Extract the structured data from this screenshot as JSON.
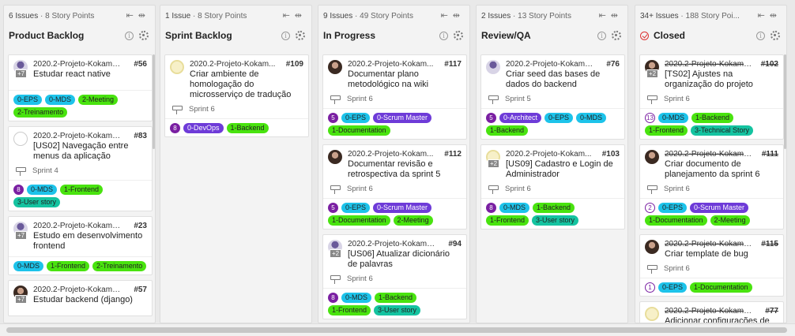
{
  "columns": [
    {
      "meta_count": "6 Issues",
      "meta_points": "8 Story Points",
      "title": "Product Backlog",
      "closed": false,
      "cards": [
        {
          "project": "2020.2-Projeto-Kokama...",
          "number": "#56",
          "title": "Estudar react native",
          "avatar": "purple",
          "plus": "+7",
          "sprint": "",
          "points": "",
          "labels": [
            {
              "text": "0-EPS",
              "color": "#1dc3ea"
            },
            {
              "text": "0-MDS",
              "color": "#1dc3ea"
            },
            {
              "text": "2-Meeting",
              "color": "#49e30f"
            },
            {
              "text": "2-Treinamento",
              "color": "#49e30f"
            }
          ]
        },
        {
          "project": "2020.2-Projeto-Kokama...",
          "number": "#83",
          "title": "[US02] Navegação entre menus da aplicação",
          "avatar": "blank",
          "plus": "",
          "sprint": "Sprint 4",
          "points": "8",
          "labels": [
            {
              "text": "0-MDS",
              "color": "#1dc3ea"
            },
            {
              "text": "1-Frontend",
              "color": "#49e30f"
            },
            {
              "text": "3-User story",
              "color": "#14c3a0"
            }
          ]
        },
        {
          "project": "2020.2-Projeto-Kokama...",
          "number": "#23",
          "title": "Estudo em desenvolvimento frontend",
          "avatar": "purple",
          "plus": "+7",
          "sprint": "",
          "points": "",
          "labels": [
            {
              "text": "0-MDS",
              "color": "#1dc3ea"
            },
            {
              "text": "1-Frontend",
              "color": "#49e30f"
            },
            {
              "text": "2-Treinamento",
              "color": "#49e30f"
            }
          ]
        },
        {
          "project": "2020.2-Projeto-Kokama...",
          "number": "#57",
          "title": "Estudar backend (django)",
          "avatar": "dark",
          "plus": "+7",
          "sprint": "",
          "points": "",
          "labels": []
        }
      ]
    },
    {
      "meta_count": "1 Issue",
      "meta_points": "8 Story Points",
      "title": "Sprint Backlog",
      "closed": false,
      "cards": [
        {
          "project": "2020.2-Projeto-Kokam...",
          "number": "#109",
          "title": "Criar ambiente de homologação do microsserviço de tradução",
          "avatar": "yellow",
          "plus": "",
          "sprint": "Sprint 6",
          "points": "8",
          "labels": [
            {
              "text": "0-DevOps",
              "color": "#6e3bd8"
            },
            {
              "text": "1-Backend",
              "color": "#49e30f"
            }
          ]
        }
      ]
    },
    {
      "meta_count": "9 Issues",
      "meta_points": "49 Story Points",
      "title": "In Progress",
      "closed": false,
      "cards": [
        {
          "project": "2020.2-Projeto-Kokam...",
          "number": "#117",
          "title": "Documentar plano metodológico na wiki",
          "avatar": "dark",
          "plus": "",
          "sprint": "Sprint 6",
          "points": "5",
          "labels": [
            {
              "text": "0-EPS",
              "color": "#1dc3ea"
            },
            {
              "text": "0-Scrum Master",
              "color": "#6e3bd8"
            },
            {
              "text": "1-Documentation",
              "color": "#49e30f"
            }
          ]
        },
        {
          "project": "2020.2-Projeto-Kokam...",
          "number": "#112",
          "title": "Documentar revisão e retrospectiva da sprint 5",
          "avatar": "dark",
          "plus": "",
          "sprint": "Sprint 6",
          "points": "5",
          "labels": [
            {
              "text": "0-EPS",
              "color": "#1dc3ea"
            },
            {
              "text": "0-Scrum Master",
              "color": "#6e3bd8"
            },
            {
              "text": "1-Documentation",
              "color": "#49e30f"
            },
            {
              "text": "2-Meeting",
              "color": "#49e30f"
            }
          ]
        },
        {
          "project": "2020.2-Projeto-Kokama...",
          "number": "#94",
          "title": "[US06] Atualizar dicionário de palavras",
          "avatar": "purple",
          "plus": "+2",
          "sprint": "Sprint 6",
          "points": "8",
          "labels": [
            {
              "text": "0-MDS",
              "color": "#1dc3ea"
            },
            {
              "text": "1-Backend",
              "color": "#49e30f"
            },
            {
              "text": "1-Frontend",
              "color": "#49e30f"
            },
            {
              "text": "3-User story",
              "color": "#14c3a0"
            }
          ]
        }
      ]
    },
    {
      "meta_count": "2 Issues",
      "meta_points": "13 Story Points",
      "title": "Review/QA",
      "closed": false,
      "cards": [
        {
          "project": "2020.2-Projeto-Kokama...",
          "number": "#76",
          "title": "Criar seed das bases de dados do backend",
          "avatar": "purple",
          "plus": "",
          "sprint": "Sprint 5",
          "points": "5",
          "labels": [
            {
              "text": "0-Architect",
              "color": "#6e3bd8"
            },
            {
              "text": "0-EPS",
              "color": "#1dc3ea"
            },
            {
              "text": "0-MDS",
              "color": "#1dc3ea"
            },
            {
              "text": "1-Backend",
              "color": "#49e30f"
            }
          ]
        },
        {
          "project": "2020.2-Projeto-Kokam...",
          "number": "#103",
          "title": "[US09] Cadastro e Login de Administrador",
          "avatar": "yellow",
          "plus": "+2",
          "sprint": "Sprint 6",
          "points": "8",
          "labels": [
            {
              "text": "0-MDS",
              "color": "#1dc3ea"
            },
            {
              "text": "1-Backend",
              "color": "#49e30f"
            },
            {
              "text": "1-Frontend",
              "color": "#49e30f"
            },
            {
              "text": "3-User story",
              "color": "#14c3a0"
            }
          ]
        }
      ]
    },
    {
      "meta_count": "34+ Issues",
      "meta_points": "188 Story Poi...",
      "title": "Closed",
      "closed": true,
      "cards": [
        {
          "project": "2020.2-Projeto-Kokama...",
          "number": "#102",
          "title": "[TS02] Ajustes na organização do projeto",
          "avatar": "dark",
          "plus": "+2",
          "sprint": "Sprint 6",
          "points": "13",
          "labels": [
            {
              "text": "0-MDS",
              "color": "#1dc3ea"
            },
            {
              "text": "1-Backend",
              "color": "#49e30f"
            },
            {
              "text": "1-Frontend",
              "color": "#49e30f"
            },
            {
              "text": "3-Technical Story",
              "color": "#14c3a0"
            }
          ]
        },
        {
          "project": "2020.2-Projeto-Kokama...",
          "number": "#111",
          "title": "Criar documento de planejamento da sprint 6",
          "avatar": "dark",
          "plus": "",
          "sprint": "Sprint 6",
          "points": "2",
          "labels": [
            {
              "text": "0-EPS",
              "color": "#1dc3ea"
            },
            {
              "text": "0-Scrum Master",
              "color": "#6e3bd8"
            },
            {
              "text": "1-Documentation",
              "color": "#49e30f"
            },
            {
              "text": "2-Meeting",
              "color": "#49e30f"
            }
          ]
        },
        {
          "project": "2020.2-Projeto-Kokama...",
          "number": "#115",
          "title": "Criar template de bug",
          "avatar": "dark",
          "plus": "",
          "sprint": "Sprint 6",
          "points": "1",
          "labels": [
            {
              "text": "0-EPS",
              "color": "#1dc3ea"
            },
            {
              "text": "1-Documentation",
              "color": "#49e30f"
            }
          ]
        },
        {
          "project": "2020.2-Projeto-Kokama...",
          "number": "#77",
          "title": "Adicionar configurações de lint",
          "avatar": "yellow",
          "plus": "",
          "sprint": "",
          "points": "",
          "labels": []
        }
      ]
    }
  ]
}
